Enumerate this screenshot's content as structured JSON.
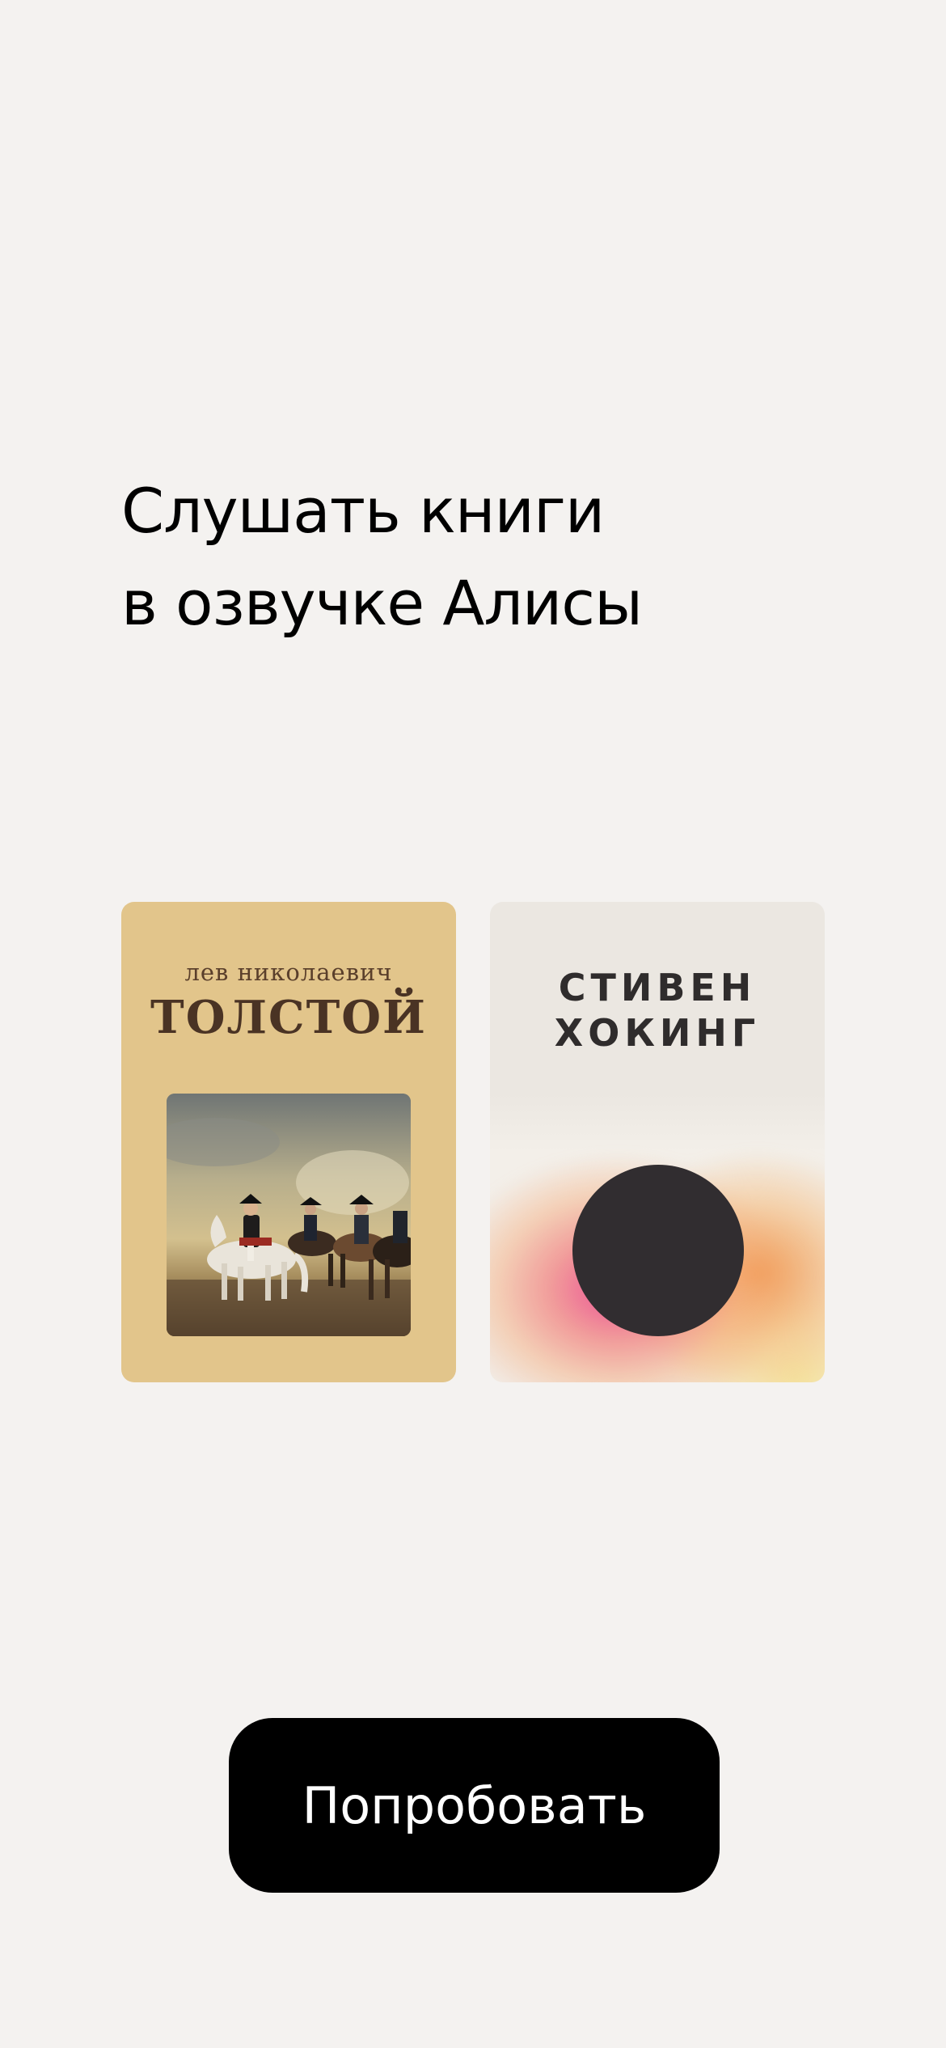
{
  "headline": {
    "line1": "Слушать книги",
    "line2": "в озвучке Алисы"
  },
  "books": [
    {
      "author_first": "лев николаевич",
      "author_last": "ТОЛСТОЙ",
      "cover_color": "#e2c58b"
    },
    {
      "author_line1": "СТИВЕН",
      "author_line2": "ХОКИНГ",
      "cover_color": "#ebe7e1"
    }
  ],
  "cta": {
    "label": "Попробовать"
  },
  "colors": {
    "background": "#f4f2f0",
    "cta_background": "#000000",
    "cta_text": "#ffffff"
  }
}
